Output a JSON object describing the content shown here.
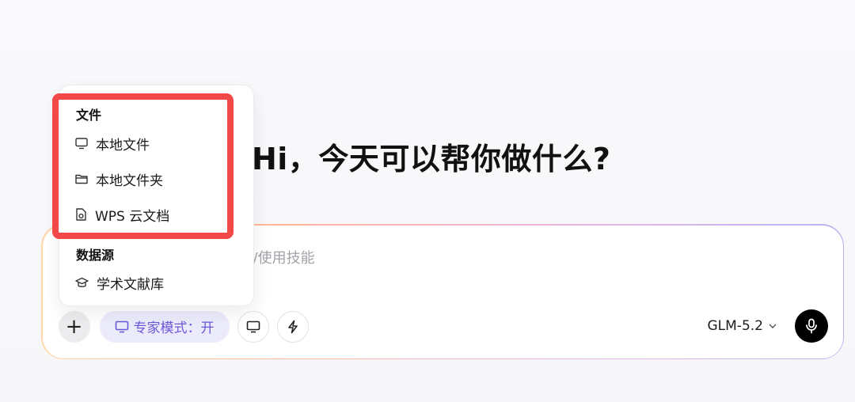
{
  "hero": {
    "title": "Hi，今天可以帮你做什么?"
  },
  "composer": {
    "placeholder": "/使用技能",
    "plus_label": "+",
    "expert_mode_label": "专家模式：开",
    "model_label": "GLM-5.2"
  },
  "menu": {
    "sections": [
      {
        "title": "文件",
        "items": [
          {
            "label": "本地文件",
            "icon": "monitor-icon"
          },
          {
            "label": "本地文件夹",
            "icon": "folder-icon"
          },
          {
            "label": "WPS 云文档",
            "icon": "cloud-document-icon"
          }
        ]
      },
      {
        "title": "数据源",
        "items": [
          {
            "label": "学术文献库",
            "icon": "graduation-cap-icon"
          }
        ]
      }
    ]
  },
  "colors": {
    "accent_purple": "#6b58d9",
    "highlight_red": "#f24848",
    "mic_black": "#000000"
  }
}
